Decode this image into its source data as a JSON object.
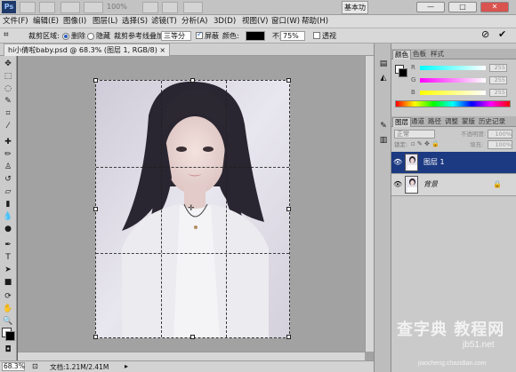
{
  "app": {
    "logo": "Ps",
    "zoom_display": "100%",
    "workspace": "基本功"
  },
  "menu": [
    "文件(F)",
    "编辑(E)",
    "图像(I)",
    "图层(L)",
    "选择(S)",
    "滤镜(T)",
    "分析(A)",
    "3D(D)",
    "视图(V)",
    "窗口(W)",
    "帮助(H)"
  ],
  "options": {
    "crop_area_label": "裁剪区域:",
    "delete_label": "删除",
    "hide_label": "隐藏",
    "overlay_label": "裁剪参考线叠加:",
    "overlay_value": "三等分",
    "shield_label": "屏蔽",
    "color_label": "颜色:",
    "opacity_label": "不透明度:",
    "opacity_value": "75%",
    "perspective_label": "透视",
    "delete_selected": true,
    "shield_checked": true,
    "perspective_checked": false,
    "shield_color": "#000000"
  },
  "document": {
    "tab_label": "hi小倩啦baby.psd @ 68.3% (图层 1, RGB/8) ×"
  },
  "status": {
    "zoom": "68.3%",
    "doc_info": "文档:1.21M/2.41M"
  },
  "color_panel": {
    "tabs": [
      "颜色",
      "色板",
      "样式"
    ],
    "sliders": [
      {
        "letter": "R",
        "value": "255",
        "colors": [
          "#00ffff",
          "#ffffff"
        ]
      },
      {
        "letter": "G",
        "value": "255",
        "colors": [
          "#ff00ff",
          "#ffffff"
        ]
      },
      {
        "letter": "B",
        "value": "255",
        "colors": [
          "#ffff00",
          "#ffffff"
        ]
      }
    ]
  },
  "layers_panel": {
    "tabs": [
      "图层",
      "通道",
      "路径",
      "调整",
      "蒙版",
      "历史记录"
    ],
    "blend_mode": "正常",
    "opacity_label": "不透明度:",
    "opacity_value": "100%",
    "lock_label": "锁定:",
    "fill_label": "填充:",
    "fill_value": "100%",
    "layers": [
      {
        "name": "图层 1",
        "selected": true
      },
      {
        "name": "背景",
        "selected": false
      }
    ]
  },
  "watermark": {
    "line1": "查字典 教程网",
    "line2": "jb51.net",
    "line3": "jiaocheng.chazidian.com"
  }
}
